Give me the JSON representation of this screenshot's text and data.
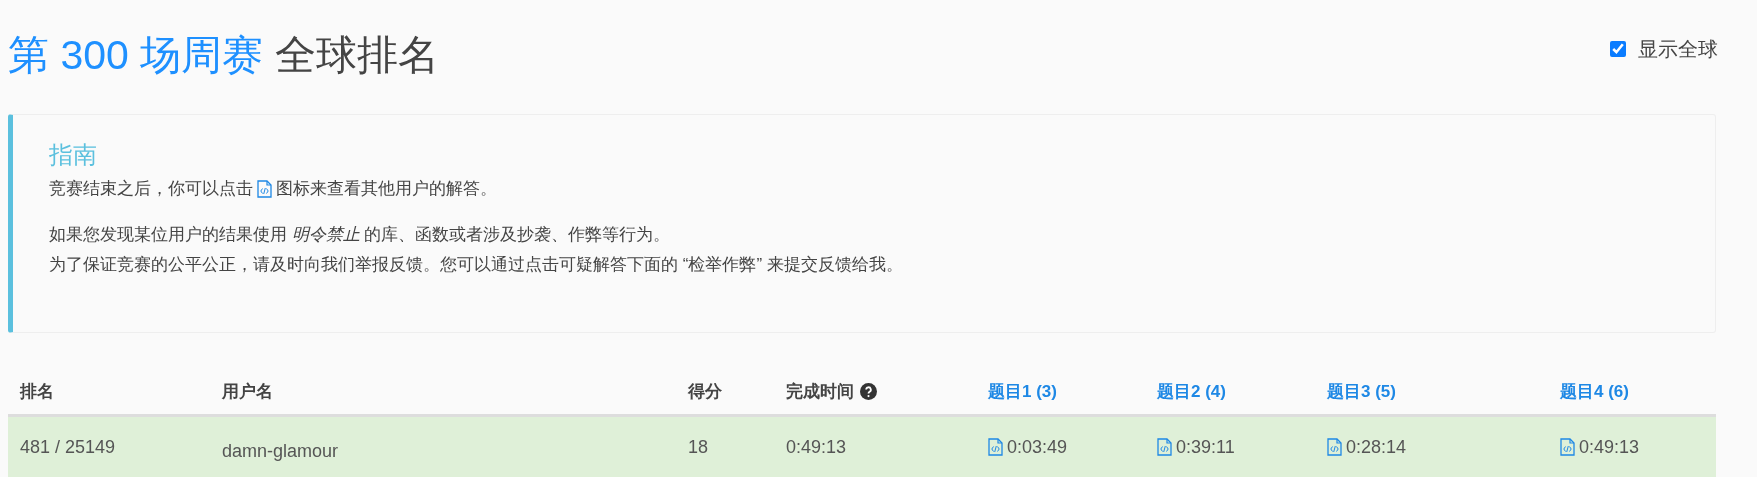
{
  "title": {
    "contest": "第 300 场周赛",
    "suffix": "全球排名"
  },
  "global_toggle": {
    "label": "显示全球",
    "checked": true
  },
  "guide": {
    "heading": "指南",
    "line1_before": "竞赛结束之后，你可以点击",
    "line1_after": "图标来查看其他用户的解答。",
    "paragraphs": [
      "如果您发现某位用户的结果使用 *明令禁止* 的库、函数或者涉及抄袭、作弊等行为。",
      "为了保证竞赛的公平公正，请及时向我们举报反馈。您可以通过点击可疑解答下面的 “检举作弊” 来提交反馈给我。"
    ]
  },
  "table": {
    "columns": [
      {
        "label": "排名",
        "kind": "plain"
      },
      {
        "label": "用户名",
        "kind": "plain"
      },
      {
        "label": "得分",
        "kind": "plain"
      },
      {
        "label": "完成时间",
        "kind": "help"
      },
      {
        "label": "题目1 (3)",
        "kind": "link"
      },
      {
        "label": "题目2 (4)",
        "kind": "link"
      },
      {
        "label": "题目3 (5)",
        "kind": "link"
      },
      {
        "label": "题目4 (6)",
        "kind": "link"
      }
    ],
    "rows": [
      {
        "rank": "481 / 25149",
        "username": "damn-glamour",
        "score": "18",
        "finish_time": "0:49:13",
        "highlighted": true,
        "problems": [
          "0:03:49",
          "0:39:11",
          "0:28:14",
          "0:49:13"
        ]
      }
    ]
  }
}
